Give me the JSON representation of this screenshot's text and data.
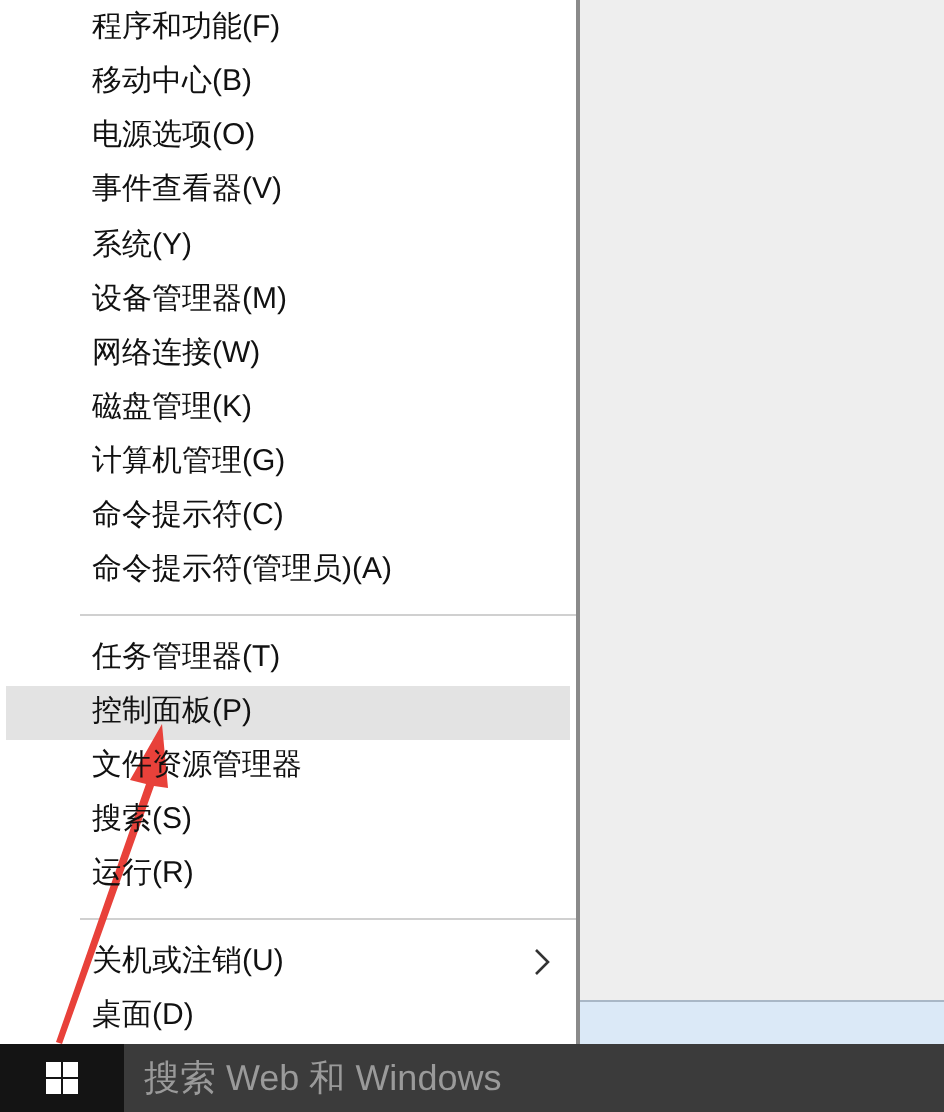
{
  "menu": {
    "groups": [
      {
        "items": [
          {
            "label": "程序和功能(F)",
            "selected": false,
            "submenu": false
          },
          {
            "label": "移动中心(B)",
            "selected": false,
            "submenu": false
          },
          {
            "label": "电源选项(O)",
            "selected": false,
            "submenu": false
          },
          {
            "label": "事件查看器(V)",
            "selected": false,
            "submenu": false
          },
          {
            "label": "系统(Y)",
            "selected": false,
            "submenu": false
          },
          {
            "label": "设备管理器(M)",
            "selected": false,
            "submenu": false
          },
          {
            "label": "网络连接(W)",
            "selected": false,
            "submenu": false
          },
          {
            "label": "磁盘管理(K)",
            "selected": false,
            "submenu": false
          },
          {
            "label": "计算机管理(G)",
            "selected": false,
            "submenu": false
          },
          {
            "label": "命令提示符(C)",
            "selected": false,
            "submenu": false
          },
          {
            "label": "命令提示符(管理员)(A)",
            "selected": false,
            "submenu": false
          }
        ]
      },
      {
        "items": [
          {
            "label": "任务管理器(T)",
            "selected": false,
            "submenu": false
          },
          {
            "label": "控制面板(P)",
            "selected": true,
            "submenu": false
          },
          {
            "label": "文件资源管理器",
            "selected": false,
            "submenu": false
          },
          {
            "label": "搜索(S)",
            "selected": false,
            "submenu": false
          },
          {
            "label": "运行(R)",
            "selected": false,
            "submenu": false
          }
        ]
      },
      {
        "items": [
          {
            "label": "关机或注销(U)",
            "selected": false,
            "submenu": true
          },
          {
            "label": "桌面(D)",
            "selected": false,
            "submenu": false
          }
        ]
      }
    ]
  },
  "taskbar": {
    "search": {
      "placeholder": "搜索 Web 和 Windows"
    }
  }
}
